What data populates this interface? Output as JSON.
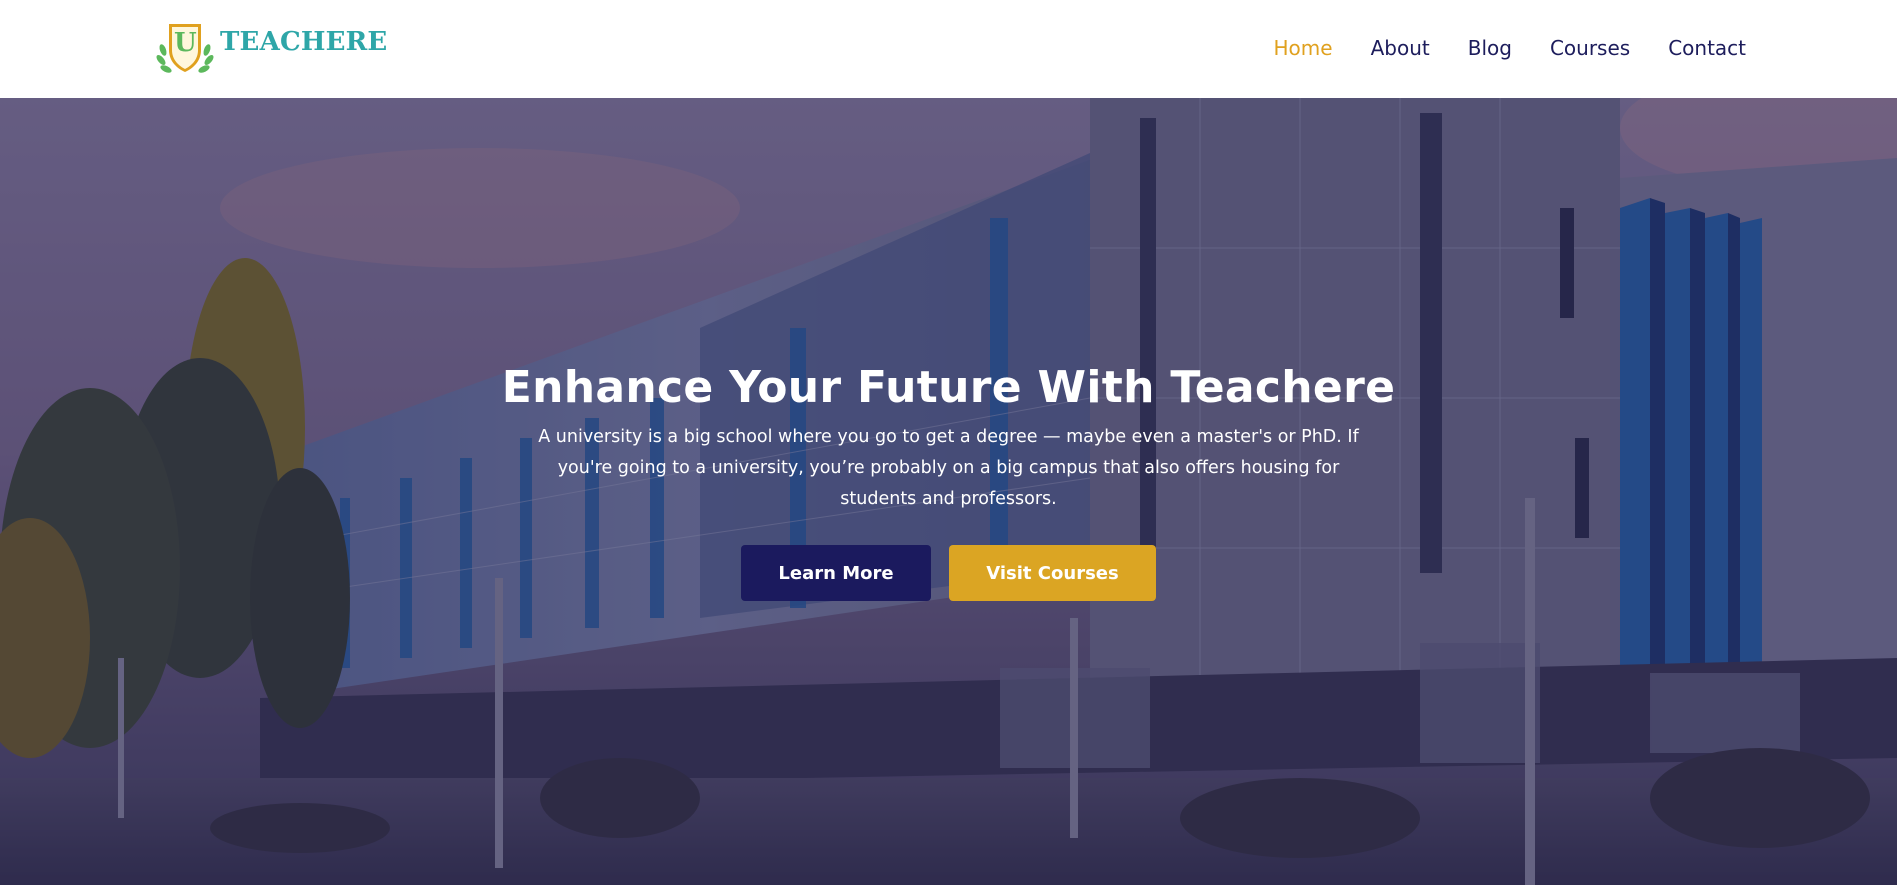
{
  "brand": {
    "name": "TEACHERE",
    "logo_letter": "U",
    "colors": {
      "teal": "#2ea6a8",
      "gold": "#e0a11f",
      "navy": "#1b1a5e"
    }
  },
  "nav": {
    "items": [
      {
        "label": "Home",
        "active": true
      },
      {
        "label": "About",
        "active": false
      },
      {
        "label": "Blog",
        "active": false
      },
      {
        "label": "Courses",
        "active": false
      },
      {
        "label": "Contact",
        "active": false
      }
    ]
  },
  "hero": {
    "title": "Enhance Your Future With Teachere",
    "description": "A university is a big school where you go to get a degree — maybe even a master's or PhD. If you're going to a university, you’re probably on a big campus that also offers housing for students and professors.",
    "primary_button": "Learn More",
    "secondary_button": "Visit Courses",
    "background": "university campus building at dusk"
  }
}
